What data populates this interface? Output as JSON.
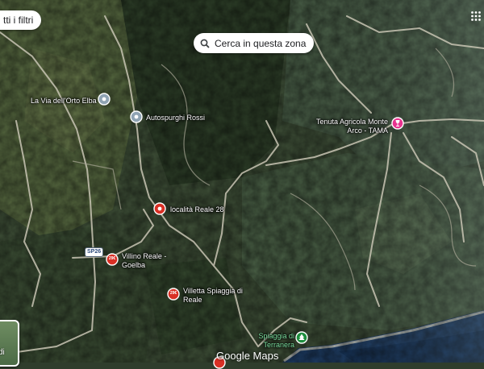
{
  "controls": {
    "filters_label": "tti i filtri",
    "search_area_label": "Cerca in questa zona",
    "layer_tile_label": "di",
    "apps_icon": "grid-icon"
  },
  "places": [
    {
      "name": "La Via dell'Orto Elba",
      "icon": "place-pin-icon",
      "color": "#8fa3b3"
    },
    {
      "name": "Autospurghi Rossi",
      "icon": "place-pin-icon",
      "color": "#8fa3b3"
    },
    {
      "name": "località Reale 28",
      "icon": "place-pin-icon",
      "color": "#d93025"
    },
    {
      "name": "Villino Reale - Goelba",
      "icon": "lodging-pin-icon",
      "color": "#d93025",
      "price": "29€"
    },
    {
      "name": "Villetta Spiaggia di Reale",
      "icon": "lodging-pin-icon",
      "color": "#d93025",
      "price": "29€"
    },
    {
      "name": "Tenuta Agricola Monte Arco - TAMA",
      "icon": "winery-pin-icon",
      "color": "#e8338f"
    },
    {
      "name": "Spiaggia di Terranera",
      "icon": "park-pin-icon",
      "color": "#1e8e3e"
    }
  ],
  "road_badge": "SP26",
  "logo_text": "Google Maps"
}
